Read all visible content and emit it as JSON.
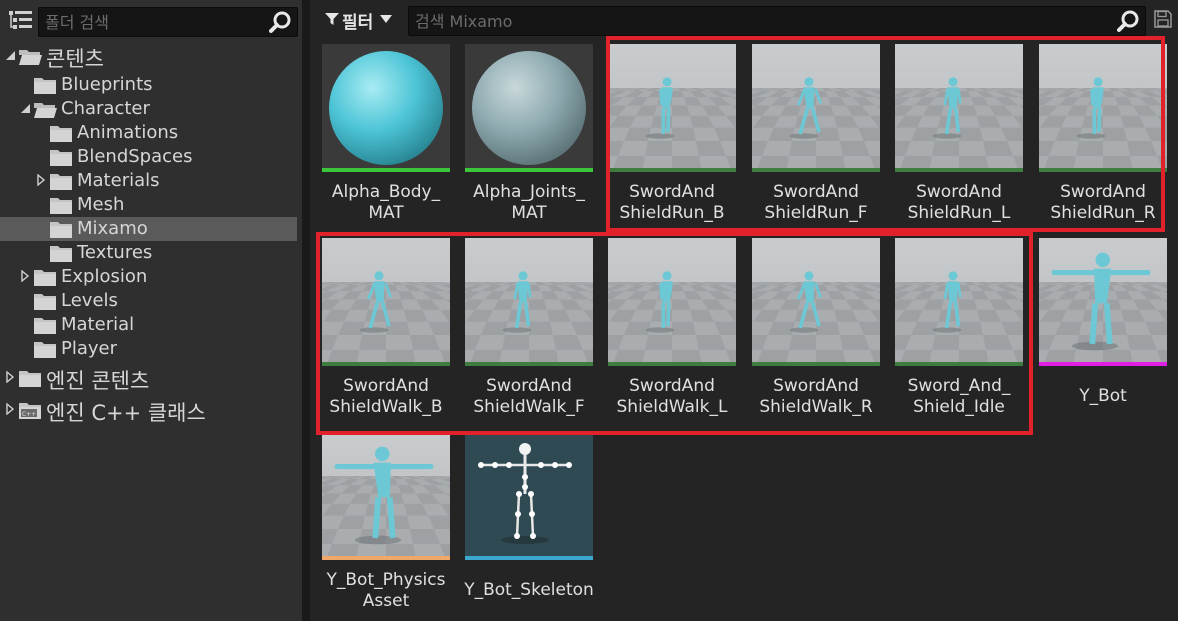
{
  "folder_search": {
    "placeholder": "폴더 검색"
  },
  "tree": [
    {
      "label": "콘텐츠",
      "depth": 0,
      "arrow": "open",
      "big": true
    },
    {
      "label": "Blueprints",
      "depth": 1,
      "arrow": "none"
    },
    {
      "label": "Character",
      "depth": 1,
      "arrow": "open"
    },
    {
      "label": "Animations",
      "depth": 2,
      "arrow": "none"
    },
    {
      "label": "BlendSpaces",
      "depth": 2,
      "arrow": "none"
    },
    {
      "label": "Materials",
      "depth": 2,
      "arrow": "closed"
    },
    {
      "label": "Mesh",
      "depth": 2,
      "arrow": "none"
    },
    {
      "label": "Mixamo",
      "depth": 2,
      "arrow": "none",
      "selected": true
    },
    {
      "label": "Textures",
      "depth": 2,
      "arrow": "none"
    },
    {
      "label": "Explosion",
      "depth": 1,
      "arrow": "closed"
    },
    {
      "label": "Levels",
      "depth": 1,
      "arrow": "none"
    },
    {
      "label": "Material",
      "depth": 1,
      "arrow": "none"
    },
    {
      "label": "Player",
      "depth": 1,
      "arrow": "none"
    },
    {
      "label": "엔진 콘텐츠",
      "depth": 0,
      "arrow": "closed",
      "big": true
    },
    {
      "label": "엔진 C++ 클래스",
      "depth": 0,
      "arrow": "closed",
      "big": true,
      "cpp": true
    }
  ],
  "filter_label": "필터",
  "asset_search": {
    "placeholder": "검색 Mixamo"
  },
  "assets": [
    {
      "line1": "Alpha_Body_",
      "line2": "MAT",
      "kind": "sphere-bright",
      "bar": "#3cc63c"
    },
    {
      "line1": "Alpha_Joints_",
      "line2": "MAT",
      "kind": "sphere-dull",
      "bar": "#3cc63c"
    },
    {
      "line1": "SwordAnd",
      "line2": "ShieldRun_B",
      "kind": "anim",
      "bar": "#3f7c3f"
    },
    {
      "line1": "SwordAnd",
      "line2": "ShieldRun_F",
      "kind": "anim",
      "bar": "#3f7c3f"
    },
    {
      "line1": "SwordAnd",
      "line2": "ShieldRun_L",
      "kind": "anim",
      "bar": "#3f7c3f"
    },
    {
      "line1": "SwordAnd",
      "line2": "ShieldRun_R",
      "kind": "anim",
      "bar": "#3f7c3f"
    },
    {
      "line1": "SwordAnd",
      "line2": "ShieldWalk_B",
      "kind": "anim",
      "bar": "#3f7c3f"
    },
    {
      "line1": "SwordAnd",
      "line2": "ShieldWalk_F",
      "kind": "anim",
      "bar": "#3f7c3f"
    },
    {
      "line1": "SwordAnd",
      "line2": "ShieldWalk_L",
      "kind": "anim",
      "bar": "#3f7c3f"
    },
    {
      "line1": "SwordAnd",
      "line2": "ShieldWalk_R",
      "kind": "anim",
      "bar": "#3f7c3f"
    },
    {
      "line1": "Sword_And_",
      "line2": "Shield_Idle",
      "kind": "anim",
      "bar": "#3f7c3f"
    },
    {
      "line1": "Y_Bot",
      "line2": "",
      "kind": "tpose",
      "bar": "#e020e0"
    },
    {
      "line1": "Y_Bot_Physics",
      "line2": "Asset",
      "kind": "tpose",
      "bar": "#f0a868"
    },
    {
      "line1": "Y_Bot_Skeleton",
      "line2": "",
      "kind": "skeleton",
      "bar": "#3ca8d0"
    }
  ],
  "colors": {
    "highlight": "#e2222a",
    "character": "#6cc8d4",
    "selection": "#5a5a5a"
  }
}
